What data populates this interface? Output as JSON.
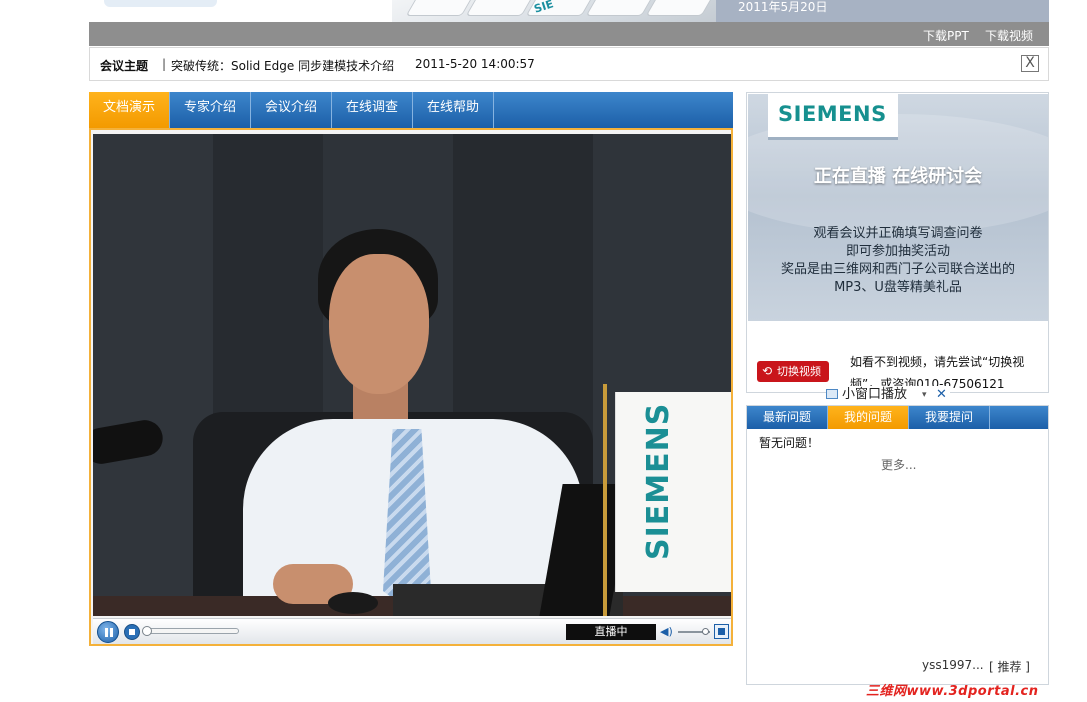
{
  "top_banner": {
    "keyboard_text": "SIE",
    "date": "2011年5月20日"
  },
  "download_bar": {
    "download_ppt": "下载PPT",
    "download_video": "下载视频"
  },
  "topic": {
    "label": "会议主题",
    "separator": "|",
    "title": "突破传统：Solid Edge 同步建模技术介绍",
    "time": "2011-5-20 14:00:57",
    "close_label": "X"
  },
  "tabs": [
    {
      "label": "文档演示",
      "active": true
    },
    {
      "label": "专家介绍",
      "active": false
    },
    {
      "label": "会议介绍",
      "active": false
    },
    {
      "label": "在线调查",
      "active": false
    },
    {
      "label": "在线帮助",
      "active": false
    }
  ],
  "player": {
    "flag_text": "SIEMENS",
    "status": "直播中",
    "volume_symbol": "◀)",
    "progress": 0.0
  },
  "ad": {
    "logo": "SIEMENS",
    "title": "正在直播  在线研讨会",
    "lines": [
      "观看会议并正确填写调查问卷",
      "即可参加抽奖活动",
      "奖品是由三维网和西门子公司联合送出的",
      "MP3、U盘等精美礼品"
    ],
    "switch_label": "切换视频",
    "tip": "如看不到视频，请先尝试“切换视频”，或咨询010-67506121",
    "mini_window": "小窗口播放",
    "mini_arrow": "▾",
    "mini_close": "✕"
  },
  "questions": {
    "tabs": [
      {
        "label": "最新问题",
        "active": false
      },
      {
        "label": "我的问题",
        "active": true
      },
      {
        "label": "我要提问",
        "active": false
      }
    ],
    "empty_text": "暂无问题！",
    "more": "更多...",
    "user": "yss1997...",
    "recommend": "[ 推荐 ]"
  },
  "watermark": "三维网www.3dportal.cn",
  "colors": {
    "tab_blue": "#1c5fa8",
    "tab_active_orange": "#f39a00",
    "siemens_teal": "#16908f",
    "switch_red": "#c9151b"
  }
}
